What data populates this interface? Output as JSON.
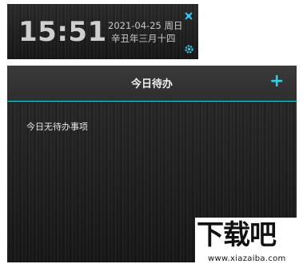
{
  "clock": {
    "time": "15:51",
    "date": "2021-04-25 周日",
    "lunar": "辛丑年三月十四",
    "pin_icon": "pin-icon",
    "settings_icon": "gear-icon",
    "accent": "#35c8ee"
  },
  "todo": {
    "title": "今日待办",
    "add_label": "+",
    "empty_text": "今日无待办事项",
    "divider_color": "#2bd0d8"
  },
  "watermark": {
    "logo_text": "下载吧",
    "url": "www.xiazaiba.com"
  }
}
